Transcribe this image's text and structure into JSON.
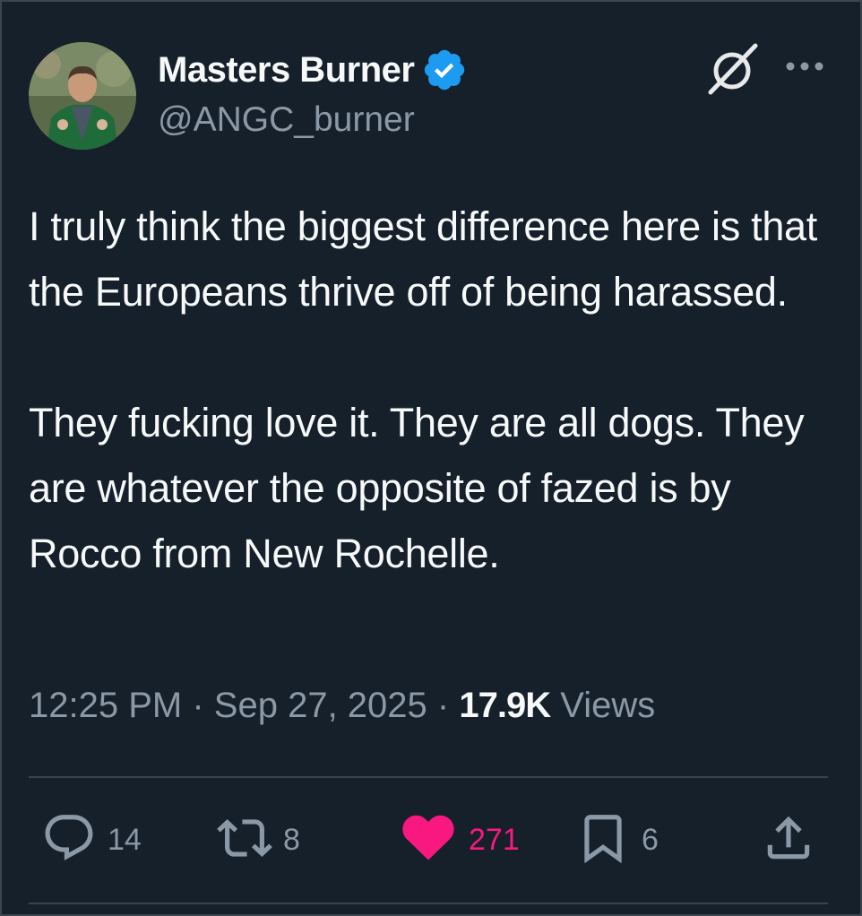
{
  "author": {
    "display_name": "Masters Burner",
    "handle": "@ANGC_burner",
    "verified": true,
    "verified_color": "#1d9bf0"
  },
  "tweet": {
    "text": "I truly think the biggest difference here is that the Europeans thrive off of being harassed.\n\nThey fucking love it. They are all dogs. They are whatever the opposite of fazed is by Rocco from New Rochelle."
  },
  "meta": {
    "time": "12:25 PM",
    "separator": "·",
    "date": "Sep 27, 2025",
    "views_count": "17.9K",
    "views_label": "Views"
  },
  "actions": {
    "replies": "14",
    "reposts": "8",
    "likes": "271",
    "bookmarks": "6"
  },
  "icons": {
    "header": [
      "grok-icon",
      "more-icon"
    ],
    "actions": [
      "reply-icon",
      "repost-icon",
      "like-icon",
      "bookmark-icon",
      "share-icon"
    ]
  },
  "colors": {
    "background": "#15202b",
    "text": "#f7f9f9",
    "secondary_text": "#8b98a5",
    "like": "#f91880",
    "divider": "#38444d"
  }
}
